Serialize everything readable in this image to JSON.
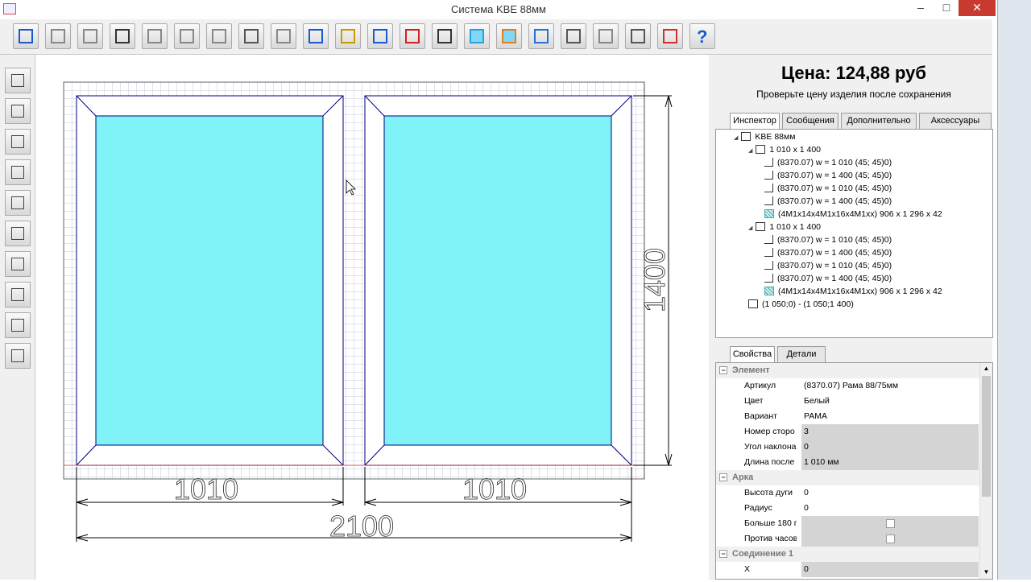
{
  "window": {
    "title": "Система KBE 88мм",
    "minimize_glyph": "–",
    "maximize_glyph": "□",
    "close_glyph": "✕"
  },
  "toolbar": {
    "icons": [
      "save-icon",
      "add-impost-horizontal-icon",
      "add-impost-vertical-icon",
      "grid-icon",
      "split-horizontal-icon",
      "split-vertical-icon",
      "add-sash-icon",
      "info-icon",
      "sash-pair-icon",
      "undo-icon",
      "calculator-icon",
      "frame-3d-icon",
      "delete-icon",
      "label-icon",
      "glass-icon",
      "glass-frame-icon",
      "sash-blue-icon",
      "ruler-icon",
      "add-panel-icon",
      "add-mullion-icon",
      "marker-icon",
      "help-icon"
    ],
    "help_label": "?"
  },
  "left_tools": [
    "add-element-icon",
    "delete-element-icon",
    "edit-icon",
    "diagonal-icon",
    "remove-icon",
    "corner-icon",
    "arc-icon",
    "insert-icon",
    "connector-horizontal-icon",
    "connector-double-icon"
  ],
  "drawing": {
    "dim_left": "1010",
    "dim_right": "1010",
    "dim_total": "2100",
    "dim_height": "1400"
  },
  "price": {
    "label": "Цена: 124,88 руб",
    "note": "Проверьте цену изделия после сохранения"
  },
  "top_tabs": [
    "Инспектор",
    "Сообщения",
    "Дополнительно",
    "Аксессуары"
  ],
  "tree": [
    {
      "text": "KBE 88мм",
      "icon": "frame-k-icon"
    },
    {
      "text": "1 010 x 1 400",
      "icon": "sash-icon"
    },
    {
      "text": "(8370.07) w = 1 010 (45; 45)0)",
      "icon": "profile-icon"
    },
    {
      "text": "(8370.07) w = 1 400 (45; 45)0)",
      "icon": "profile-icon"
    },
    {
      "text": "(8370.07) w = 1 010 (45; 45)0)",
      "icon": "profile-icon"
    },
    {
      "text": "(8370.07) w = 1 400 (45; 45)0)",
      "icon": "profile-icon"
    },
    {
      "text": "(4M1x14x4M1x16x4M1xx) 906 x 1 296 x 42",
      "icon": "glass-icon"
    },
    {
      "text": "1 010 x 1 400",
      "icon": "sash-icon"
    },
    {
      "text": "(8370.07) w = 1 010 (45; 45)0)",
      "icon": "profile-icon"
    },
    {
      "text": "(8370.07) w = 1 400 (45; 45)0)",
      "icon": "profile-icon"
    },
    {
      "text": "(8370.07) w = 1 010 (45; 45)0)",
      "icon": "profile-icon"
    },
    {
      "text": "(8370.07) w = 1 400 (45; 45)0)",
      "icon": "profile-icon"
    },
    {
      "text": "(4M1x14x4M1x16x4M1xx) 906 x 1 296 x 42",
      "icon": "glass-icon"
    },
    {
      "text": "(1 050;0) - (1 050;1 400)",
      "icon": "impost-icon"
    }
  ],
  "bottom_tabs": [
    "Свойства",
    "Детали"
  ],
  "props": {
    "cat_element": "Элемент",
    "artikul": {
      "name": "Артикул",
      "value": "(8370.07) Рама 88/75мм"
    },
    "color": {
      "name": "Цвет",
      "value": "Белый"
    },
    "variant": {
      "name": "Вариант",
      "value": "РАМА"
    },
    "side": {
      "name": "Номер сторо",
      "value": "3"
    },
    "angle": {
      "name": "Угол наклона",
      "value": "0"
    },
    "length": {
      "name": "Длина после",
      "value": "1 010 мм"
    },
    "cat_arc": "Арка",
    "arc_height": {
      "name": "Высота дуги",
      "value": "0"
    },
    "radius": {
      "name": "Радиус",
      "value": "0"
    },
    "more180": {
      "name": "Больше 180 г"
    },
    "ccw": {
      "name": "Против часов"
    },
    "cat_conn": "Соединение 1",
    "x": {
      "name": "X",
      "value": "0"
    }
  },
  "colors": {
    "glass": "#7ff3f7",
    "frame_line": "#00007f",
    "grid": "#b8b8d8"
  }
}
